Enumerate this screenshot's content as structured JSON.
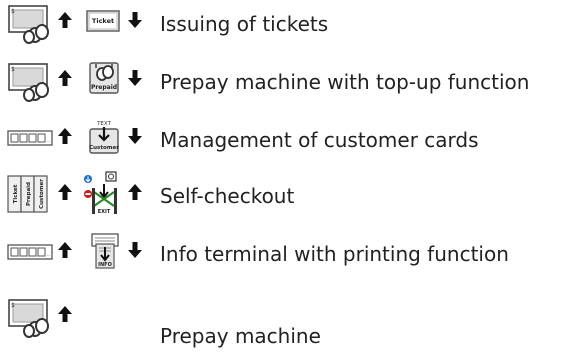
{
  "items": [
    {
      "label": "Issuing of tickets",
      "input_icon": "cash-card-icon",
      "output_icon": "ticket-icon",
      "output_text": "Ticket"
    },
    {
      "label": "Prepay machine with top-up function",
      "input_icon": "cash-card-icon",
      "output_icon": "prepaid-card-icon",
      "output_text": "Prepaid"
    },
    {
      "label": "Management of customer cards",
      "input_icon": "card-reader-display-icon",
      "output_icon": "customer-card-icon",
      "output_text": "Customer",
      "output_text_top": "TEXT"
    },
    {
      "label": "Self-checkout",
      "input_icon": "ticket-prepaid-customer-stack-icon",
      "output_icon": "exit-barrier-icon",
      "output_text": "EXIT",
      "stack_texts": [
        "Ticket",
        "Prepaid",
        "Customer"
      ]
    },
    {
      "label": "Info terminal with printing function",
      "input_icon": "card-reader-display-icon",
      "output_icon": "info-printer-icon",
      "output_text": "INFO"
    },
    {
      "label": "Prepay machine",
      "input_icon": "cash-card-icon"
    }
  ]
}
